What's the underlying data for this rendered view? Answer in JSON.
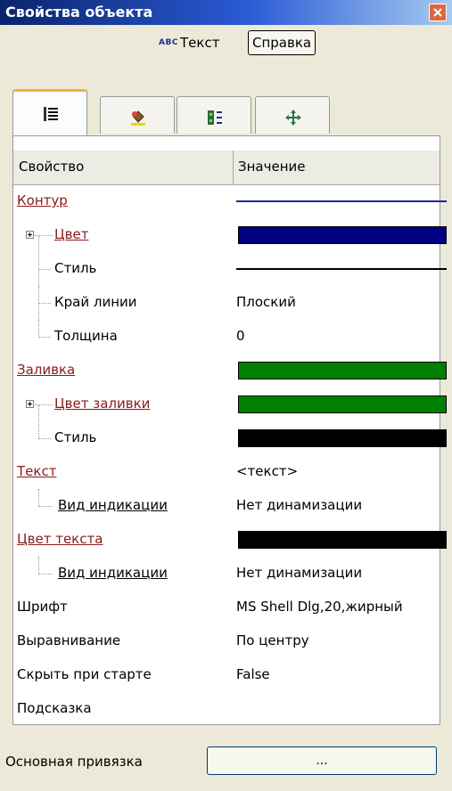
{
  "window": {
    "title": "Свойства объекта"
  },
  "header": {
    "type_icon_text": "ABC",
    "object_type": "Текст",
    "help_button": "Справка"
  },
  "tabs": [
    {
      "icon": "list-properties-icon",
      "active": true
    },
    {
      "icon": "paint-bucket-icon",
      "active": false
    },
    {
      "icon": "linked-panel-icon",
      "active": false
    },
    {
      "icon": "move-arrows-icon",
      "active": false
    }
  ],
  "grid": {
    "columns": [
      "Свойство",
      "Значение"
    ],
    "rows": [
      {
        "label": "Контур",
        "kind": "category",
        "value_type": "line",
        "color": "#1c2a9a"
      },
      {
        "label": "Цвет",
        "kind": "expand",
        "value_type": "swatch",
        "color": "#000080"
      },
      {
        "label": "Стиль",
        "kind": "child",
        "value_type": "line",
        "color": "#000000"
      },
      {
        "label": "Край линии",
        "kind": "child",
        "value": "Плоский"
      },
      {
        "label": "Толщина",
        "kind": "child-last",
        "value": "0"
      },
      {
        "label": "Заливка",
        "kind": "category",
        "value_type": "swatch",
        "color": "#007f00"
      },
      {
        "label": "Цвет заливки",
        "kind": "expand",
        "value_type": "swatch",
        "color": "#007f00"
      },
      {
        "label": "Стиль",
        "kind": "child-last",
        "value_type": "swatch",
        "color": "#000000"
      },
      {
        "label": "Текст",
        "kind": "category",
        "value": "<текст>"
      },
      {
        "label": "Вид индикации",
        "kind": "sub",
        "value": "Нет динамизации"
      },
      {
        "label": "Цвет текста",
        "kind": "category",
        "value_type": "swatch",
        "color": "#000000"
      },
      {
        "label": "Вид индикации",
        "kind": "sub",
        "value": "Нет динамизации"
      },
      {
        "label": "Шрифт",
        "kind": "plain",
        "value": "MS Shell Dlg,20,жирный"
      },
      {
        "label": "Выравнивание",
        "kind": "plain",
        "value": "По центру"
      },
      {
        "label": "Скрыть при старте",
        "kind": "plain",
        "value": "False"
      },
      {
        "label": "Подсказка",
        "kind": "plain",
        "value": ""
      }
    ]
  },
  "footer": {
    "binding_label": "Основная привязка",
    "browse_button": "..."
  },
  "colors": {
    "title_bar": "#0a246a",
    "category_text": "#8b1a1a",
    "close_button": "#e06640"
  }
}
